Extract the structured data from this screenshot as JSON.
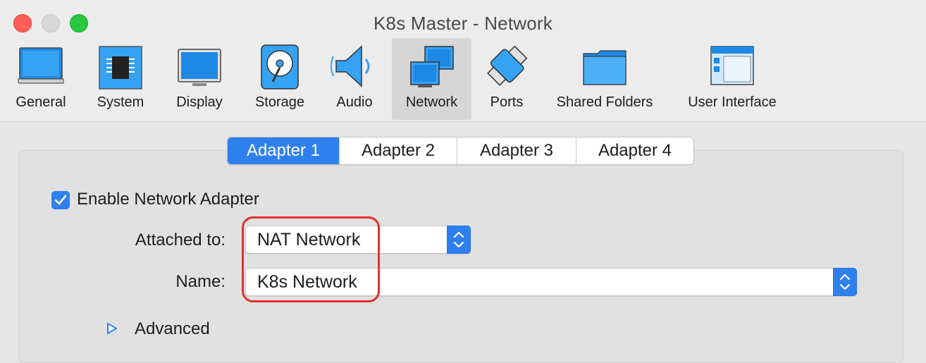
{
  "window": {
    "title": "K8s Master - Network"
  },
  "toolbar": {
    "items": [
      {
        "label": "General",
        "icon": "general-icon",
        "selected": false
      },
      {
        "label": "System",
        "icon": "system-chip-icon",
        "selected": false
      },
      {
        "label": "Display",
        "icon": "display-monitor-icon",
        "selected": false
      },
      {
        "label": "Storage",
        "icon": "storage-disk-icon",
        "selected": false
      },
      {
        "label": "Audio",
        "icon": "audio-speaker-icon",
        "selected": false
      },
      {
        "label": "Network",
        "icon": "network-icon",
        "selected": true
      },
      {
        "label": "Ports",
        "icon": "ports-icon",
        "selected": false
      },
      {
        "label": "Shared Folders",
        "icon": "shared-folder-icon",
        "selected": false
      },
      {
        "label": "User Interface",
        "icon": "user-interface-icon",
        "selected": false
      }
    ]
  },
  "tabs": [
    {
      "label": "Adapter 1",
      "active": true
    },
    {
      "label": "Adapter 2",
      "active": false
    },
    {
      "label": "Adapter 3",
      "active": false
    },
    {
      "label": "Adapter 4",
      "active": false
    }
  ],
  "adapter": {
    "enable_label": "Enable Network Adapter",
    "enabled": true,
    "attached_to_label": "Attached to:",
    "attached_to_value": "NAT Network",
    "name_label": "Name:",
    "name_value": "K8s Network",
    "advanced_label": "Advanced"
  },
  "colors": {
    "accent": "#2f80ef",
    "highlight": "#e0322c"
  }
}
